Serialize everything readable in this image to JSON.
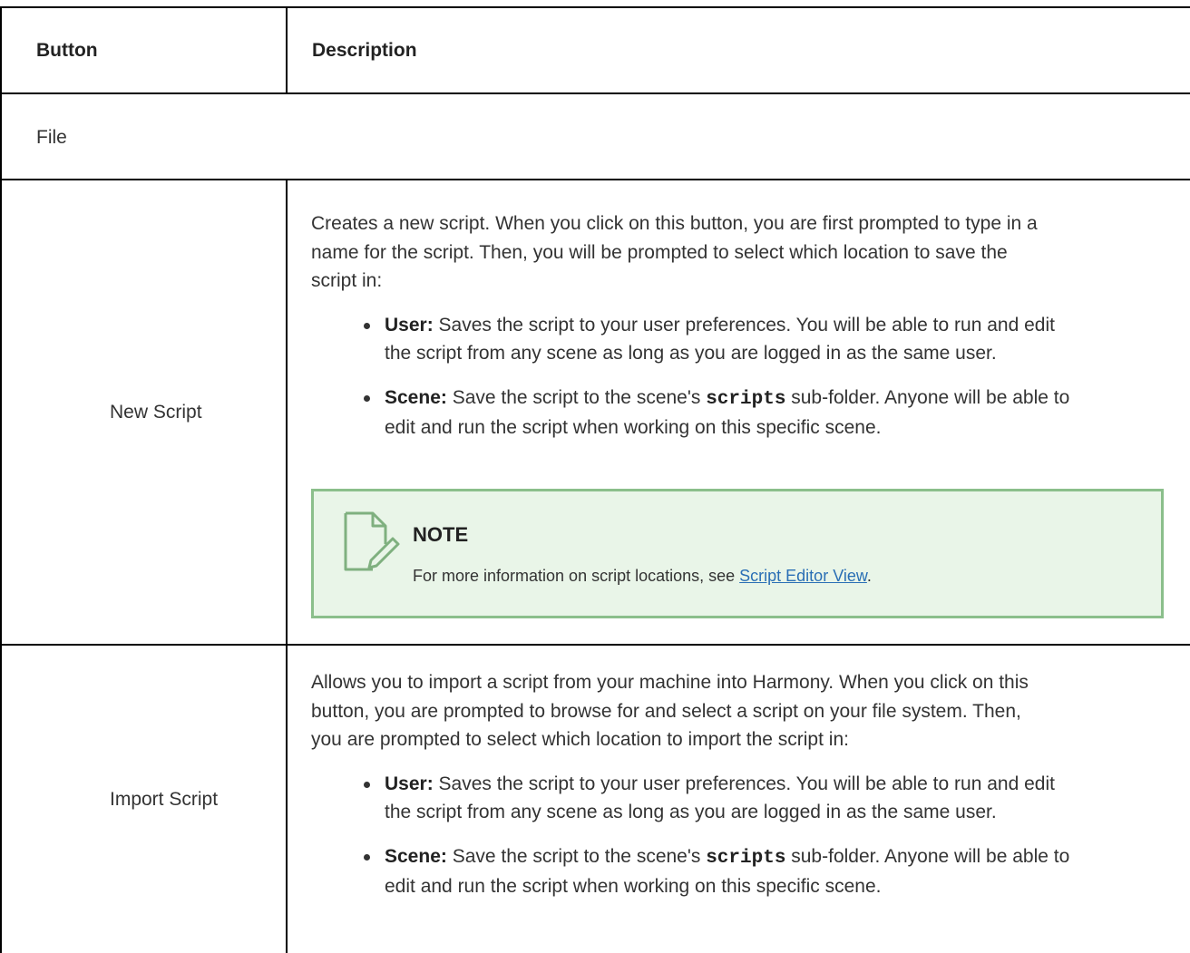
{
  "table": {
    "header": {
      "col1": "Button",
      "col2": "Description"
    },
    "section_label": "File",
    "rows": [
      {
        "button": "New Script",
        "intro_lines": [
          "Creates a new script. When you click on this button, you are first prompted to type in a",
          "name for the script. Then, you will be prompted to select which location to save the",
          "script in:"
        ],
        "bullets": [
          {
            "term": "User:",
            "line1": " Saves the script to your user preferences. You will be able to run and edit",
            "line2": "the script from any scene as long as you are logged in as the same user."
          },
          {
            "term": "Scene:",
            "line1_pre": " Save the script to the scene's ",
            "code": "scripts",
            "line1_post": " sub-folder. Anyone will be able to",
            "line2": "edit and run the script when working on this specific scene."
          }
        ],
        "note": {
          "title": "NOTE",
          "text": "For more information on script locations, see ",
          "link": "Script Editor View",
          "text_after": "."
        }
      },
      {
        "button": "Import Script",
        "intro_lines": [
          "Allows you to import a script from your machine into Harmony. When you click on this",
          "button, you are prompted to browse for and select a script on your file system. Then,",
          "you are prompted to select which location to import the script in:"
        ],
        "bullets": [
          {
            "term": "User:",
            "line1": " Saves the script to your user preferences. You will be able to run and edit",
            "line2": "the script from any scene as long as you are logged in as the same user."
          },
          {
            "term": "Scene:",
            "line1_pre": " Save the script to the scene's ",
            "code": "scripts",
            "line1_post": " sub-folder. Anyone will be able to",
            "line2": "edit and run the script when working on this specific scene."
          }
        ]
      }
    ]
  },
  "colors": {
    "border": "#000000",
    "note_border": "#8bbf8b",
    "note_bg": "#e9f5e8",
    "link": "#2a6fb5"
  }
}
